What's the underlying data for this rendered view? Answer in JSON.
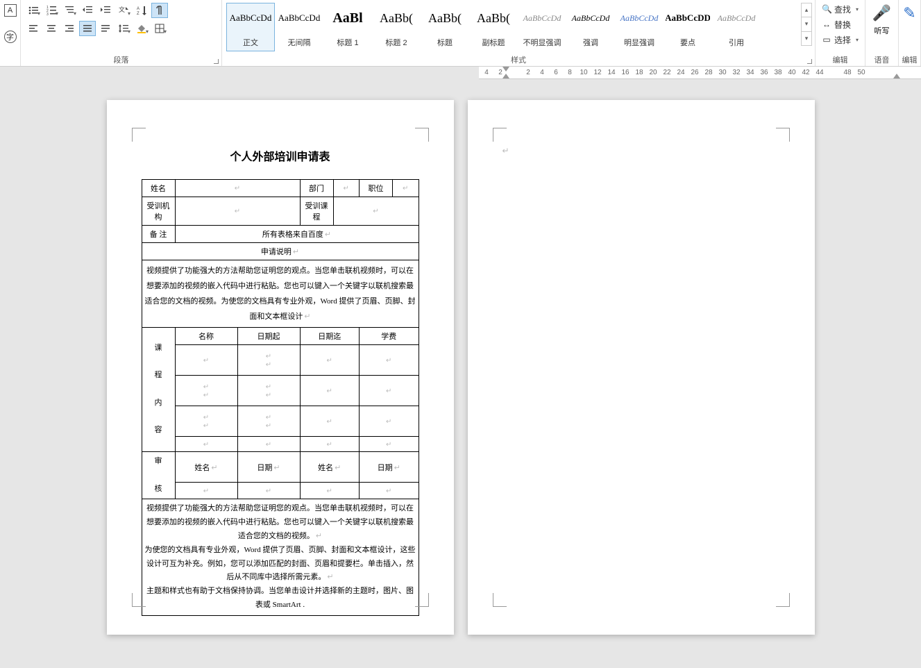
{
  "ribbon": {
    "groups": {
      "paragraph": "段落",
      "styles": "样式",
      "edit": "编辑",
      "voice": "语音",
      "editor": "编辑"
    },
    "styles": [
      {
        "preview": "AaBbCcDd",
        "name": "正文",
        "selected": true,
        "previewStyle": "font-size:13px;"
      },
      {
        "preview": "AaBbCcDd",
        "name": "无间隔",
        "previewStyle": "font-size:13px;"
      },
      {
        "preview": "AaBl",
        "name": "标题 1",
        "previewStyle": "font-size:20px;font-weight:bold;"
      },
      {
        "preview": "AaBb(",
        "name": "标题 2",
        "previewStyle": "font-size:18px;"
      },
      {
        "preview": "AaBb(",
        "name": "标题",
        "previewStyle": "font-size:18px;"
      },
      {
        "preview": "AaBb(",
        "name": "副标题",
        "previewStyle": "font-size:18px;"
      },
      {
        "preview": "AaBbCcDd",
        "name": "不明显强调",
        "previewStyle": "font-size:12px;font-style:italic;color:#888;"
      },
      {
        "preview": "AaBbCcDd",
        "name": "强调",
        "previewStyle": "font-size:12px;font-style:italic;"
      },
      {
        "preview": "AaBbCcDd",
        "name": "明显强调",
        "previewStyle": "font-size:12px;font-style:italic;color:#4472c4;"
      },
      {
        "preview": "AaBbCcDD",
        "name": "要点",
        "previewStyle": "font-size:13px;font-weight:bold;"
      },
      {
        "preview": "AaBbCcDd",
        "name": "引用",
        "previewStyle": "font-size:12px;font-style:italic;color:#888;"
      }
    ],
    "edit_items": {
      "find": "查找",
      "replace": "替换",
      "select": "选择"
    },
    "voice_label": "听写"
  },
  "ruler_ticks": [
    "4",
    "2",
    "",
    "2",
    "4",
    "6",
    "8",
    "10",
    "12",
    "14",
    "16",
    "18",
    "20",
    "22",
    "24",
    "26",
    "28",
    "30",
    "32",
    "34",
    "36",
    "38",
    "40",
    "42",
    "44",
    "",
    "48",
    "50"
  ],
  "doc": {
    "title": "个人外部培训申请表",
    "labels": {
      "name": "姓名",
      "dept": "部门",
      "position": "职位",
      "org": "受训机构",
      "course": "受训课程",
      "note": "备  注",
      "note_value": "所有表格来自百度",
      "desc": "申请说明",
      "desc_body": "视频提供了功能强大的方法帮助您证明您的观点。当您单击联机视频时，可以在想要添加的视频的嵌入代码中进行粘贴。您也可以键入一个关键字以联机搜索最适合您的文档的视频。为使您的文档具有专业外观，Word 提供了页眉、页脚、封面和文本框设计",
      "course_content": "课程内容",
      "col_name": "名称",
      "col_date_from": "日期起",
      "col_date_to": "日期迄",
      "col_fee": "学费",
      "review": "审核",
      "rev_name": "姓名",
      "rev_date": "日期",
      "footer_body1": "视频提供了功能强大的方法帮助您证明您的观点。当您单击联机视频时，可以在想要添加的视频的嵌入代码中进行粘贴。您也可以键入一个关键字以联机搜索最适合您的文档的视频。",
      "footer_body2": "为使您的文档具有专业外观，Word 提供了页眉、页脚、封面和文本框设计，这些设计可互为补充。例如，您可以添加匹配的封面、页眉和提要栏。单击插入，然后从不同库中选择所需元素。",
      "footer_body3": "主题和样式也有助于文档保持协调。当您单击设计并选择新的主题时，图片、图表或 SmartArt ."
    }
  }
}
